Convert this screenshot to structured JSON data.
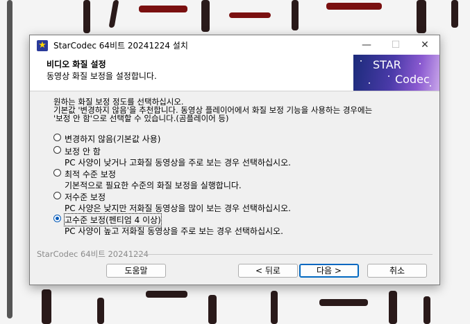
{
  "window": {
    "title": "StarCodec 64비트 20241224 설치",
    "minimize_glyph": "—",
    "maximize_glyph": "☐",
    "close_glyph": "✕"
  },
  "header": {
    "title": "비디오 화질 설정",
    "subtitle": "동영상 화질 보정을 설정합니다.",
    "logo_line1": "STAR",
    "logo_line2": "Codec"
  },
  "description": [
    "원하는 화질 보정 정도를 선택하십시오.",
    "기본값 '변경하지 않음'을 추천합니다. 동영상 플레이어에서 화질 보정 기능을 사용하는 경우에는",
    "'보정 안 함'으로 선택할 수 있습니다.(곰플레이어 등)"
  ],
  "options": [
    {
      "label": "변경하지 않음(기본값 사용)",
      "desc": "",
      "selected": false
    },
    {
      "label": "보정 안 함",
      "desc": "PC 사양이 낮거나 고화질 동영상을 주로 보는 경우 선택하십시오.",
      "selected": false
    },
    {
      "label": "최적 수준 보정",
      "desc": "기본적으로 필요한 수준의 화질 보정을 실행합니다.",
      "selected": false
    },
    {
      "label": "저수준 보정",
      "desc": "PC 사양은 낮지만 저화질 동영상을 많이 보는 경우 선택하십시오.",
      "selected": false
    },
    {
      "label": "고수준 보정(펜티엄 4 이상)",
      "desc": "PC 사양이 높고 저화질 동영상을 주로 보는 경우 선택하십시오.",
      "selected": true
    }
  ],
  "footer": {
    "brand": "StarCodec 64비트 20241224",
    "help": "도움말",
    "back": "< 뒤로",
    "next": "다음 >",
    "cancel": "취소"
  },
  "colors": {
    "accent": "#0067c0",
    "logo_gradient_start": "#1b2b7a",
    "logo_gradient_end": "#c9a6ea"
  }
}
